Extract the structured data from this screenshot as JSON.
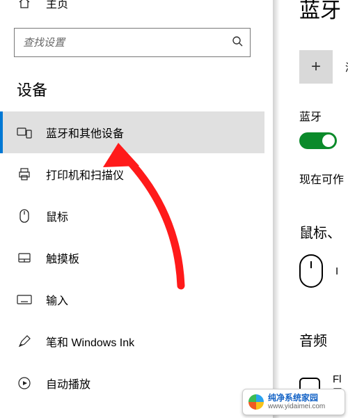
{
  "sidebar": {
    "home": "主页",
    "search_placeholder": "查找设置",
    "section": "设备",
    "items": [
      {
        "label": "蓝牙和其他设备",
        "icon": "devices-icon",
        "selected": true
      },
      {
        "label": "打印机和扫描仪",
        "icon": "printer-icon",
        "selected": false
      },
      {
        "label": "鼠标",
        "icon": "mouse-icon",
        "selected": false
      },
      {
        "label": "触摸板",
        "icon": "touchpad-icon",
        "selected": false
      },
      {
        "label": "输入",
        "icon": "keyboard-icon",
        "selected": false
      },
      {
        "label": "笔和 Windows Ink",
        "icon": "pen-icon",
        "selected": false
      },
      {
        "label": "自动播放",
        "icon": "autoplay-icon",
        "selected": false
      }
    ]
  },
  "pane": {
    "title": "蓝牙",
    "add_label": "添",
    "bt_label": "蓝牙",
    "bt_on": true,
    "discover_text": "现在可作",
    "mouse_header": "鼠标、",
    "mouse_device": "I",
    "audio_header": "音频",
    "audio_device_line1": "Fl",
    "audio_device_line2": "已"
  },
  "watermark": {
    "line1": "纯净系统家园",
    "line2": "www.yidaimei.com"
  }
}
